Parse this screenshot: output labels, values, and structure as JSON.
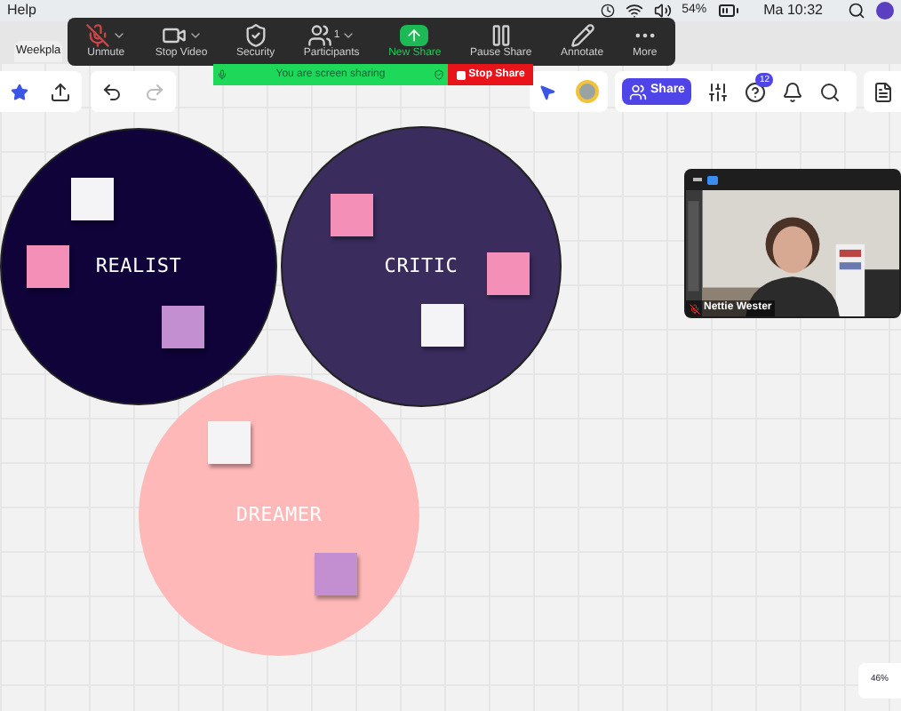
{
  "menubar": {
    "app_menu": "Help",
    "battery": "54%",
    "clock": "Ma 10:32"
  },
  "board_tab": {
    "title": "Weekpla"
  },
  "zoom_toolbar": {
    "buttons": [
      {
        "kind": "mic",
        "label": "Unmute",
        "dropdown": true,
        "selected": false
      },
      {
        "kind": "video",
        "label": "Stop Video",
        "dropdown": true,
        "selected": false
      },
      {
        "kind": "security",
        "label": "Security",
        "dropdown": false,
        "selected": false
      },
      {
        "kind": "participants",
        "label": "Participants",
        "count": "1",
        "dropdown": true,
        "selected": false
      },
      {
        "kind": "share",
        "label": "New Share",
        "dropdown": false,
        "selected": true
      },
      {
        "kind": "pause",
        "label": "Pause Share",
        "dropdown": false,
        "selected": false
      },
      {
        "kind": "annotate",
        "label": "Annotate",
        "dropdown": false,
        "selected": false
      },
      {
        "kind": "more",
        "label": "More",
        "dropdown": false,
        "selected": false
      }
    ]
  },
  "sharing_banner": {
    "message": "You are screen sharing",
    "stop_button": "Stop Share"
  },
  "board_toolbar": {
    "share_button": "Share",
    "help_badge": "12"
  },
  "circles": [
    {
      "label": "REALIST",
      "color": "#10033a",
      "notes": [
        {
          "color": "#f4f4f6"
        },
        {
          "color": "#f48fb8"
        },
        {
          "color": "#c48fd0"
        }
      ]
    },
    {
      "label": "CRITIC",
      "color": "#3b2c5e",
      "notes": [
        {
          "color": "#f48fb8"
        },
        {
          "color": "#f48fb8"
        },
        {
          "color": "#f4f4f6"
        }
      ]
    },
    {
      "label": "DREAMER",
      "color": "#ffb8b8",
      "notes": [
        {
          "color": "#f4f4f6"
        },
        {
          "color": "#c48fd0"
        }
      ]
    }
  ],
  "video_tile": {
    "name": "Nettie Wester",
    "muted": true
  },
  "zoom_level": "46%"
}
